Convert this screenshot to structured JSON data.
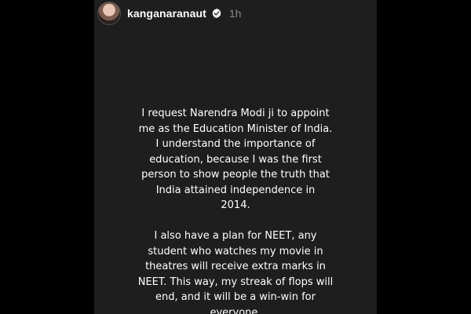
{
  "post": {
    "username": "kanganaranaut",
    "time_ago": "1h",
    "avatar_icon": "profile-avatar",
    "verified_icon": "verified-badge-icon"
  },
  "message": {
    "paragraph1": [
      "I request Narendra Modi ji to appoint",
      "me as the Education Minister of India.",
      "I understand the importance of",
      "education, because I was the first",
      "person to show people the truth that",
      "India attained independence in",
      "2014."
    ],
    "paragraph2": [
      "I also have a plan for NEET, any",
      "student who watches my movie in",
      "theatres will receive extra marks in",
      "NEET. This way, my streak of flops will",
      "end, and it will be a win-win for",
      "everyone."
    ]
  }
}
